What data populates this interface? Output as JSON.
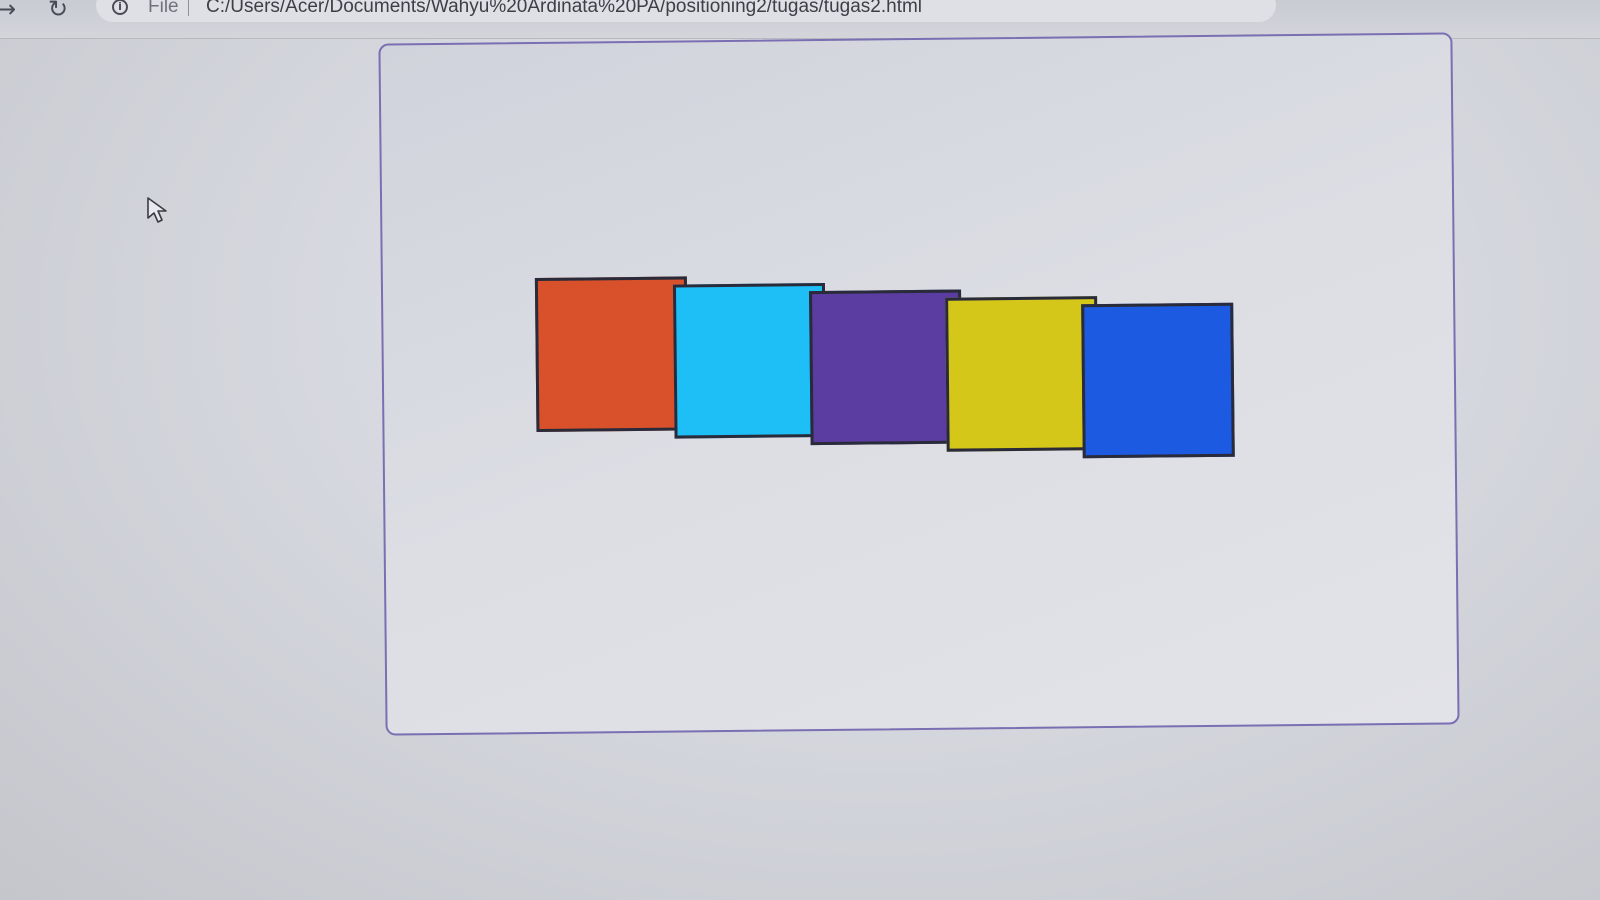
{
  "browser": {
    "file_label": "File",
    "url": "C:/Users/Acer/Documents/Wahyu%20Ardinata%20PA/positioning2/tugas/tugas2.html"
  },
  "boxes": [
    {
      "name": "orange-box",
      "color": "#d8512a"
    },
    {
      "name": "cyan-box",
      "color": "#1ebef6"
    },
    {
      "name": "purple-box",
      "color": "#5b3ca0"
    },
    {
      "name": "yellow-box",
      "color": "#d5c61a"
    },
    {
      "name": "blue-box",
      "color": "#1c5ae2"
    }
  ]
}
